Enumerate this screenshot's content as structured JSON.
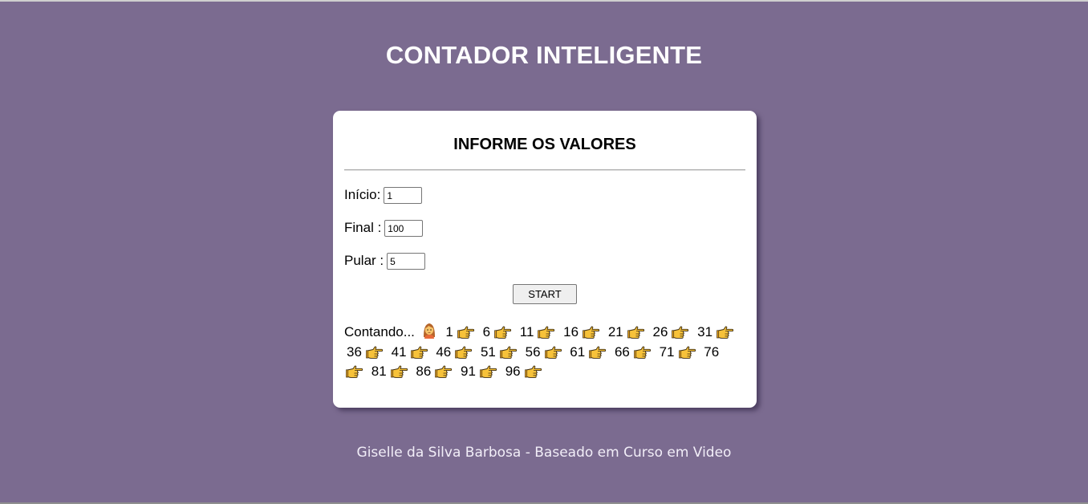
{
  "page": {
    "title": "CONTADOR INTELIGENTE",
    "footer": "Giselle da Silva Barbosa - Baseado em Curso em Video",
    "colors": {
      "background": "#7b6b90",
      "card": "#ffffff",
      "pointer_emoji": "#f7c23a"
    }
  },
  "form": {
    "heading": "INFORME OS VALORES",
    "inicio_label": "Início:",
    "inicio_value": "1",
    "final_label": "Final :",
    "final_value": "100",
    "pular_label": "Pular :",
    "pular_value": "5",
    "start_label": "START"
  },
  "result": {
    "prefix": "Contando...",
    "start_icon": "person-icon",
    "separator_icon": "pointing-hand-icon",
    "values": [
      "1",
      "6",
      "11",
      "16",
      "21",
      "26",
      "31",
      "36",
      "41",
      "46",
      "51",
      "56",
      "61",
      "66",
      "71",
      "76",
      "81",
      "86",
      "91",
      "96"
    ]
  }
}
